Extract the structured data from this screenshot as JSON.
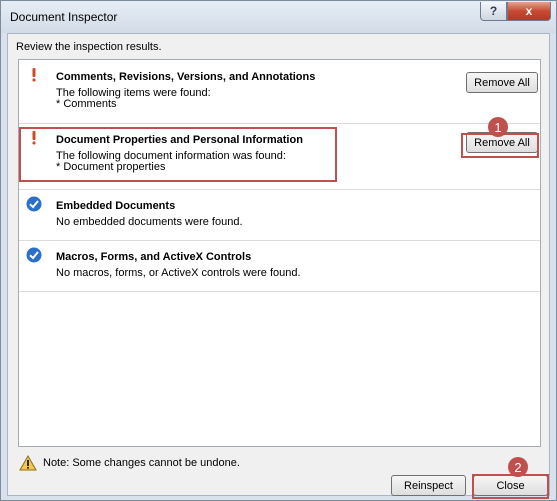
{
  "window": {
    "title": "Document Inspector",
    "help_glyph": "?",
    "close_glyph": "x"
  },
  "instructions": "Review the inspection results.",
  "items": [
    {
      "title": "Comments, Revisions, Versions, and Annotations",
      "description": "The following items were found:",
      "detail": "* Comments",
      "status_icon": "warning-exclamation-icon",
      "action_label": "Remove All"
    },
    {
      "title": "Document Properties and Personal Information",
      "description": "The following document information was found:",
      "detail": "* Document properties",
      "status_icon": "warning-exclamation-icon",
      "action_label": "Remove All"
    },
    {
      "title": "Embedded Documents",
      "description": "No embedded documents were found.",
      "status_icon": "checkmark-icon"
    },
    {
      "title": "Macros, Forms, and ActiveX Controls",
      "description": "No macros, forms, or ActiveX controls were found.",
      "status_icon": "checkmark-icon"
    }
  ],
  "footer": {
    "note": "Note: Some changes cannot be undone.",
    "reinspect_label": "Reinspect",
    "close_label": "Close"
  },
  "annotations": {
    "step1": "1",
    "step2": "2"
  },
  "colors": {
    "highlight": "#c0504d",
    "warning": "#d14a1c",
    "check": "#2a6fc9"
  }
}
